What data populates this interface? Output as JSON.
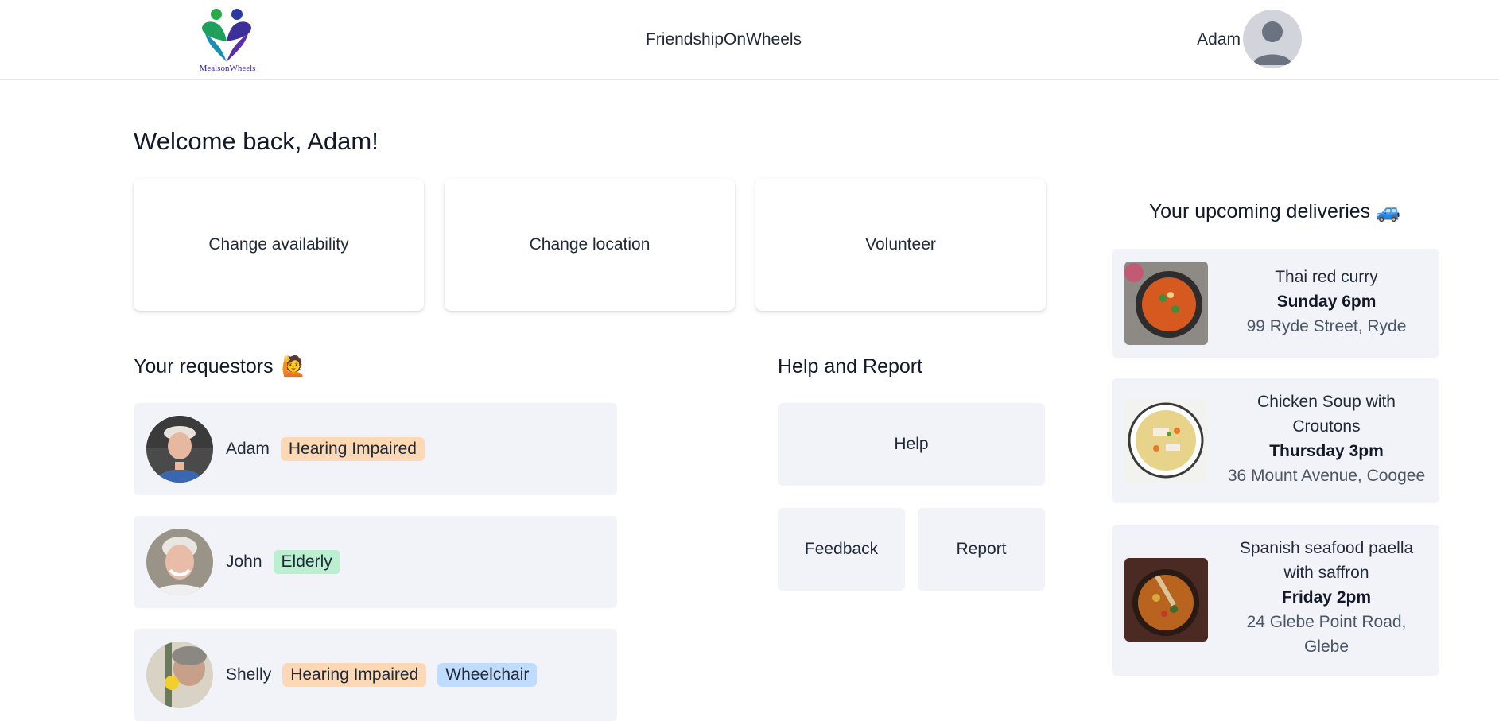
{
  "header": {
    "logo_text": "MealsonWheels",
    "brand": "FriendshipOnWheels",
    "username": "Adam"
  },
  "welcome": "Welcome back, Adam!",
  "actions": [
    {
      "label": "Change availability"
    },
    {
      "label": "Change location"
    },
    {
      "label": "Volunteer"
    }
  ],
  "requestors": {
    "title": "Your requestors",
    "title_emoji": "🙋",
    "items": [
      {
        "name": "Adam",
        "tags": [
          {
            "label": "Hearing Impaired",
            "color": "orange"
          }
        ]
      },
      {
        "name": "John",
        "tags": [
          {
            "label": "Elderly",
            "color": "green"
          }
        ]
      },
      {
        "name": "Shelly",
        "tags": [
          {
            "label": "Hearing Impaired",
            "color": "orange"
          },
          {
            "label": "Wheelchair",
            "color": "blue"
          }
        ]
      }
    ]
  },
  "help": {
    "title": "Help and Report",
    "help_label": "Help",
    "feedback_label": "Feedback",
    "report_label": "Report"
  },
  "deliveries": {
    "title": "Your upcoming deliveries",
    "title_emoji": "🚙",
    "items": [
      {
        "dish": "Thai red curry",
        "time": "Sunday 6pm",
        "address": "99 Ryde Street, Ryde"
      },
      {
        "dish": "Chicken Soup with Croutons",
        "time": "Thursday 3pm",
        "address": "36 Mount Avenue, Coogee"
      },
      {
        "dish": "Spanish seafood paella with saffron",
        "time": "Friday 2pm",
        "address": "24 Glebe Point Road, Glebe"
      }
    ]
  },
  "colors": {
    "card_bg": "#f1f3f8",
    "tag_orange": "#fcd9b4",
    "tag_green": "#bcefcf",
    "tag_blue": "#bfdbfe"
  }
}
